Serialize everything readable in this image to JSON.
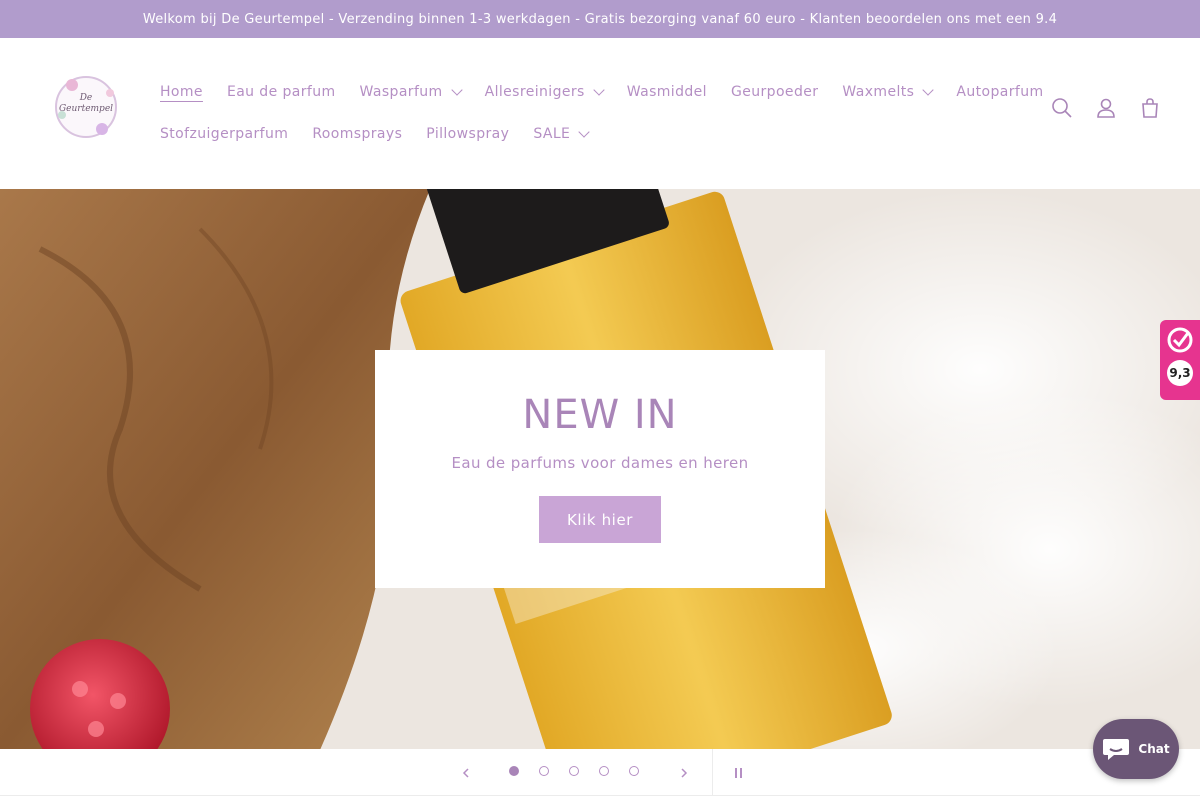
{
  "announcement": {
    "text": "Welkom bij De Geurtempel - Verzending binnen 1-3 werkdagen - Gratis bezorging vanaf 60 euro - Klanten beoordelen ons met een 9.4"
  },
  "logo": {
    "line1": "De",
    "line2": "Geurtempel"
  },
  "nav": {
    "row1": [
      {
        "label": "Home",
        "active": true
      },
      {
        "label": "Eau de parfum"
      },
      {
        "label": "Wasparfum",
        "dropdown": true
      },
      {
        "label": "Allesreinigers",
        "dropdown": true
      },
      {
        "label": "Wasmiddel"
      },
      {
        "label": "Geurpoeder"
      },
      {
        "label": "Waxmelts",
        "dropdown": true
      },
      {
        "label": "Autoparfum"
      }
    ],
    "row2": [
      {
        "label": "Stofzuigerparfum"
      },
      {
        "label": "Roomsprays"
      },
      {
        "label": "Pillowspray"
      },
      {
        "label": "SALE",
        "dropdown": true
      }
    ]
  },
  "header_icons": [
    "search-icon",
    "account-icon",
    "cart-icon"
  ],
  "hero": {
    "title": "NEW IN",
    "subtitle": "Eau de parfums voor dames en heren",
    "button": "Klik hier"
  },
  "slider": {
    "total_slides": 5,
    "current_slide": 1
  },
  "rating_badge": {
    "score": "9,3"
  },
  "chat": {
    "label": "Chat"
  },
  "colors": {
    "announcement_bg": "#b19ccc",
    "accent": "#b58fc4",
    "button_bg": "#c9a5d6",
    "chat_bg": "#6b5676",
    "badge_bg": "#e6348f"
  }
}
